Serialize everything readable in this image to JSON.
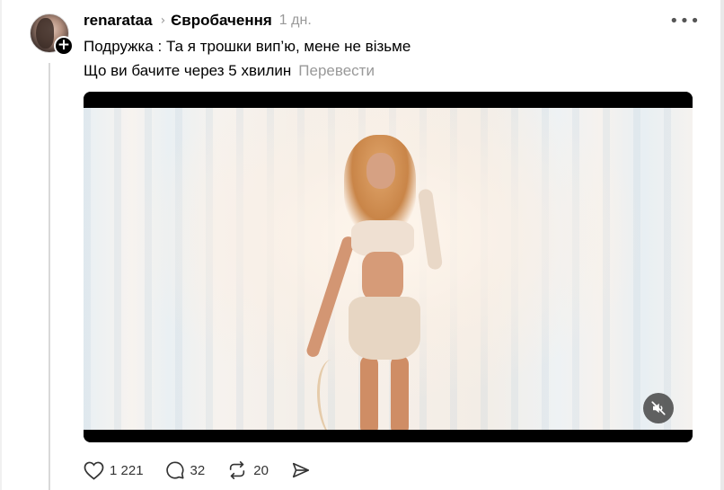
{
  "post": {
    "username": "renarataa",
    "community": "Євробачення",
    "time": "1 дн.",
    "text_line1": "Подружка : Та я трошки вип’ю, мене не візьме",
    "text_line2": "Що ви бачите через 5 хвилин",
    "translate_label": "Перевести"
  },
  "icons": {
    "follow": "plus-icon",
    "more": "more-options-icon",
    "chevron": "chevron-right-icon",
    "mute": "muted-speaker-icon",
    "like": "heart-icon",
    "reply": "comment-icon",
    "repost": "repost-icon",
    "share": "send-icon"
  },
  "actions": {
    "likes": "1 221",
    "replies": "32",
    "reposts": "20"
  },
  "colors": {
    "text": "#000000",
    "muted": "#999999",
    "thread_line": "#d9d9d9"
  }
}
